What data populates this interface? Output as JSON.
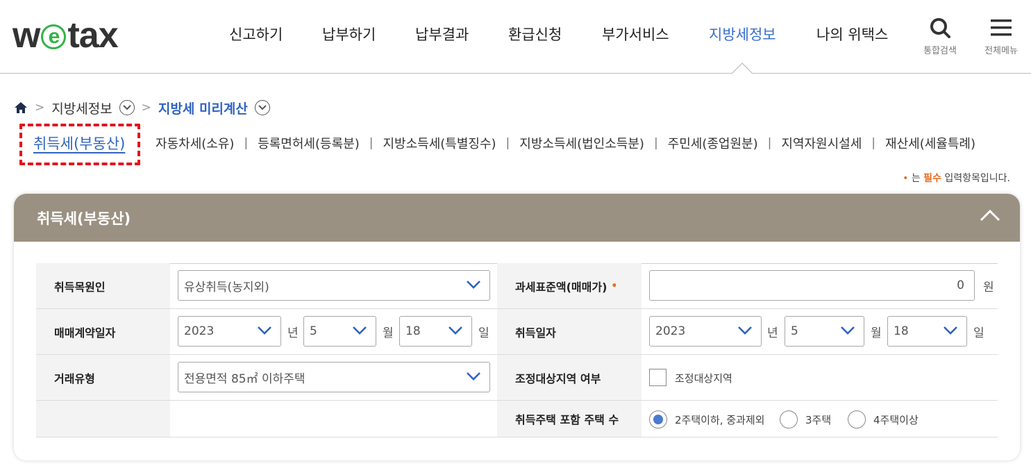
{
  "header": {
    "logo_pre": "w",
    "logo_e": "e",
    "logo_post": "tax",
    "nav": [
      "신고하기",
      "납부하기",
      "납부결과",
      "환급신청",
      "부가서비스",
      "지방세정보",
      "나의 위택스"
    ],
    "active_nav": "지방세정보",
    "search_label": "통합검색",
    "menu_label": "전체메뉴"
  },
  "breadcrumb": {
    "level1": "지방세정보",
    "level2": "지방세 미리계산"
  },
  "tabs": [
    "취득세(부동산)",
    "자동차세(소유)",
    "등록면허세(등록분)",
    "지방소득세(특별징수)",
    "지방소득세(법인소득분)",
    "주민세(종업원분)",
    "지역자원시설세",
    "재산세(세율특례)"
  ],
  "active_tab": "취득세(부동산)",
  "required_note": {
    "dot": "•",
    "pre": "는",
    "strong": "필수",
    "post": "입력항목입니다."
  },
  "panel": {
    "title": "취득세(부동산)",
    "fields": {
      "cause_label": "취득목원인",
      "cause_value": "유상취득(농지외)",
      "tax_base_label": "과세표준액(매매가)",
      "tax_base_required": "•",
      "tax_base_value": "0",
      "tax_base_unit": "원",
      "contract_date_label": "매매계약일자",
      "contract_year": "2023",
      "contract_month": "5",
      "contract_day": "18",
      "acq_date_label": "취득일자",
      "acq_year": "2023",
      "acq_month": "5",
      "acq_day": "18",
      "unit_year": "년",
      "unit_month": "월",
      "unit_day": "일",
      "deal_type_label": "거래유형",
      "deal_type_value": "전용면적 85㎡ 이하주택",
      "adjust_area_label": "조정대상지역 여부",
      "adjust_area_option": "조정대상지역",
      "adjust_area_checked": false,
      "house_count_label": "취득주택 포함 주택 수",
      "house_count_options": [
        "2주택이하, 중과제외",
        "3주택",
        "4주택이상"
      ],
      "house_count_selected": "2주택이하, 중과제외"
    }
  },
  "colors": {
    "active_blue": "#2f63c0",
    "panel_header": "#9b9182",
    "required_orange": "#e86c1f",
    "highlight_red": "#e3141f",
    "logo_green": "#33b24a"
  }
}
